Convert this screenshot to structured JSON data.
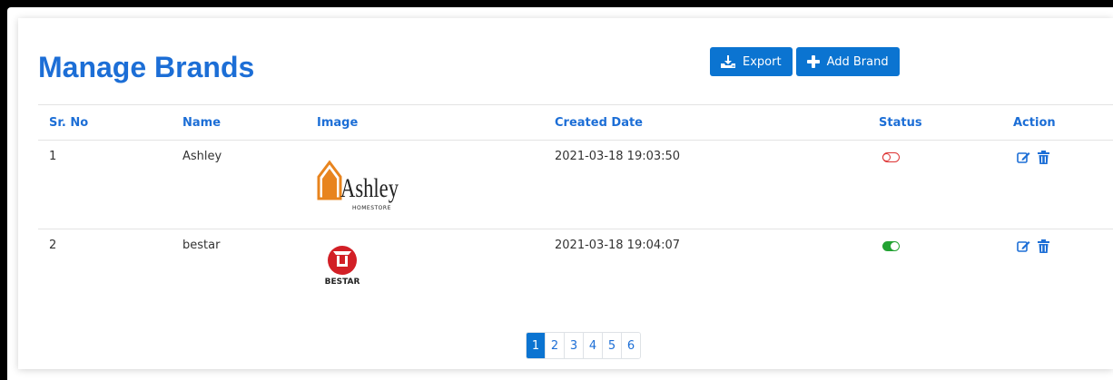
{
  "page": {
    "title": "Manage Brands"
  },
  "toolbar": {
    "export_label": "Export",
    "add_label": "Add Brand"
  },
  "table": {
    "columns": [
      "Sr. No",
      "Name",
      "Image",
      "Created Date",
      "Status",
      "Action"
    ],
    "rows": [
      {
        "sr": "1",
        "name": "Ashley",
        "created": "2021-03-18 19:03:50",
        "status": "inactive",
        "logo": {
          "text": "Ashley",
          "subtext": "HOMESTORE"
        }
      },
      {
        "sr": "2",
        "name": "bestar",
        "created": "2021-03-18 19:04:07",
        "status": "active",
        "logo": {
          "text": "BESTAR"
        }
      }
    ]
  },
  "pagination": {
    "pages": [
      "1",
      "2",
      "3",
      "4",
      "5",
      "6"
    ],
    "current": "1"
  },
  "colors": {
    "accent": "#1c6ed6",
    "button": "#0b74d1",
    "on": "#23a233",
    "off": "#d33333",
    "ashley_orange": "#e8841e",
    "bestar_red": "#d21f26"
  },
  "icons": {
    "export": "download-icon",
    "add": "plus-icon",
    "edit": "edit-icon",
    "delete": "trash-icon"
  }
}
